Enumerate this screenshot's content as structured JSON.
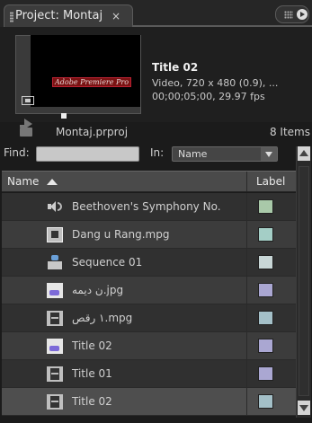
{
  "tab": {
    "title": "Project: Montaj",
    "close_glyph": "×"
  },
  "preview": {
    "clip_name": "Title 02",
    "info_line1": "Video, 720 x 480 (0.9), ...",
    "info_line2": "00;00;05;00, 29.97 fps",
    "thumb_text": "Adobe Premiere Pro"
  },
  "project": {
    "file": "Montaj.prproj",
    "count": "8 Items"
  },
  "find": {
    "label": "Find:",
    "value": "",
    "in_label": "In:",
    "in_value": "Name"
  },
  "columns": {
    "name": "Name",
    "label": "Label"
  },
  "rows": [
    {
      "name": "Beethoven's Symphony No.",
      "icon": "audio-icon",
      "label_color": "#a9c9a9"
    },
    {
      "name": "Dang u Rang.mpg",
      "icon": "audio-video-icon",
      "label_color": "#a4cec6"
    },
    {
      "name": "Sequence 01",
      "icon": "sequence-icon",
      "label_color": "#c8d6d6"
    },
    {
      "name": "ن دیمه.jpg",
      "icon": "still-image-icon",
      "label_color": "#aaa7d2"
    },
    {
      "name": "١ رقص.mpg",
      "icon": "film-icon",
      "label_color": "#a4c0c8"
    },
    {
      "name": "Title 02",
      "icon": "title-icon",
      "label_color": "#aaa7d2"
    },
    {
      "name": "Title 01",
      "icon": "film-icon",
      "label_color": "#aaa7d2"
    },
    {
      "name": "Title 02",
      "icon": "film-icon",
      "label_color": "#a4c0c8",
      "selected": true
    }
  ]
}
